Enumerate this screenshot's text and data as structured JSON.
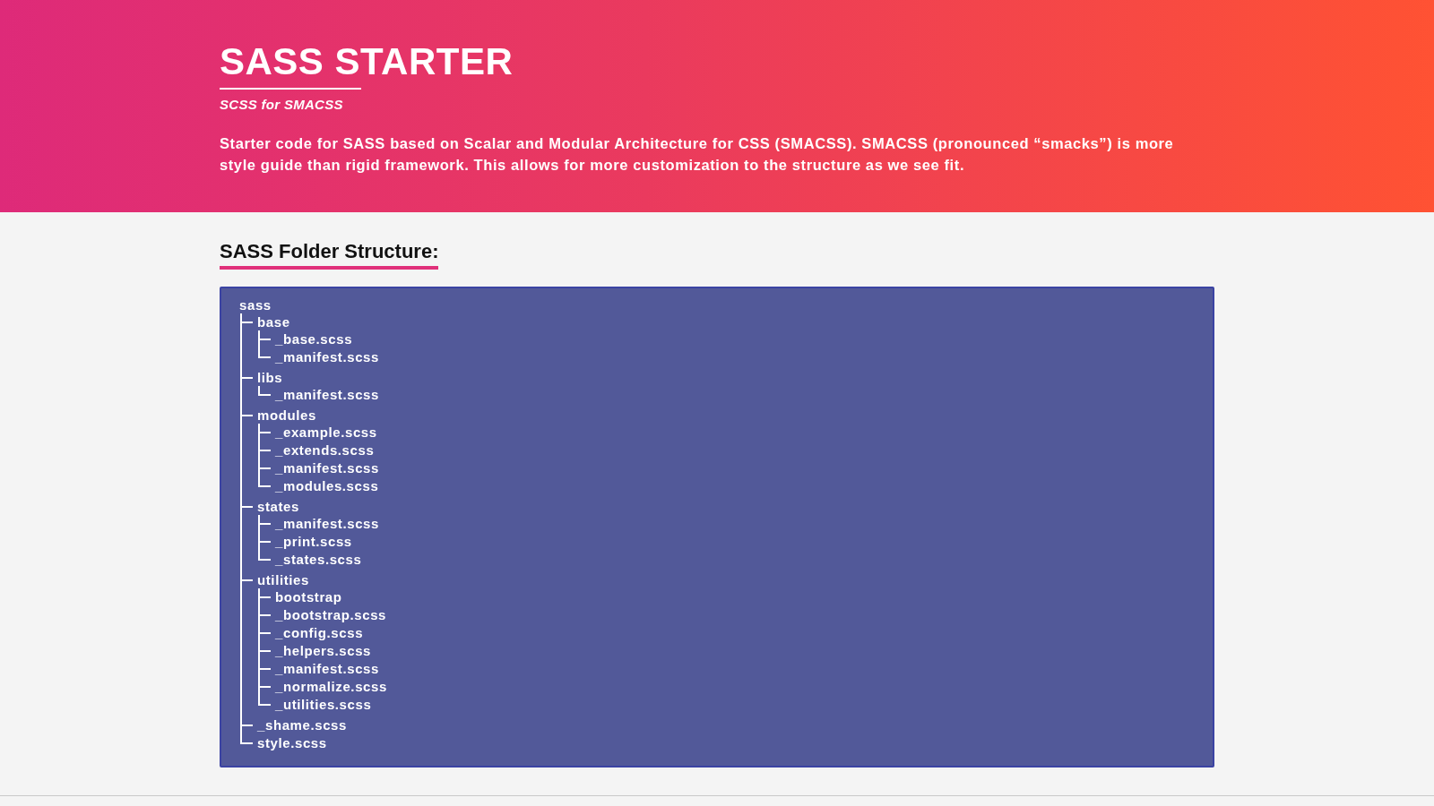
{
  "header": {
    "title": "SASS STARTER",
    "subtitle": "SCSS for SMACSS",
    "description": "Starter code for SASS based on Scalar and Modular Architecture for CSS (SMACSS). SMACSS (pronounced “smacks”) is more style guide than rigid framework. This allows for more customization to the structure as we see fit."
  },
  "section": {
    "heading": "SASS Folder Structure:"
  },
  "tree": {
    "name": "sass",
    "children": [
      {
        "name": "base",
        "children": [
          {
            "name": "_base.scss"
          },
          {
            "name": "_manifest.scss"
          }
        ]
      },
      {
        "name": "libs",
        "children": [
          {
            "name": "_manifest.scss"
          }
        ]
      },
      {
        "name": "modules",
        "children": [
          {
            "name": "_example.scss"
          },
          {
            "name": "_extends.scss"
          },
          {
            "name": "_manifest.scss"
          },
          {
            "name": "_modules.scss"
          }
        ]
      },
      {
        "name": "states",
        "children": [
          {
            "name": "_manifest.scss"
          },
          {
            "name": "_print.scss"
          },
          {
            "name": "_states.scss"
          }
        ]
      },
      {
        "name": "utilities",
        "children": [
          {
            "name": "bootstrap"
          },
          {
            "name": "_bootstrap.scss"
          },
          {
            "name": "_config.scss"
          },
          {
            "name": "_helpers.scss"
          },
          {
            "name": "_manifest.scss"
          },
          {
            "name": "_normalize.scss"
          },
          {
            "name": "_utilities.scss"
          }
        ]
      },
      {
        "name": "_shame.scss"
      },
      {
        "name": "style.scss"
      }
    ]
  }
}
